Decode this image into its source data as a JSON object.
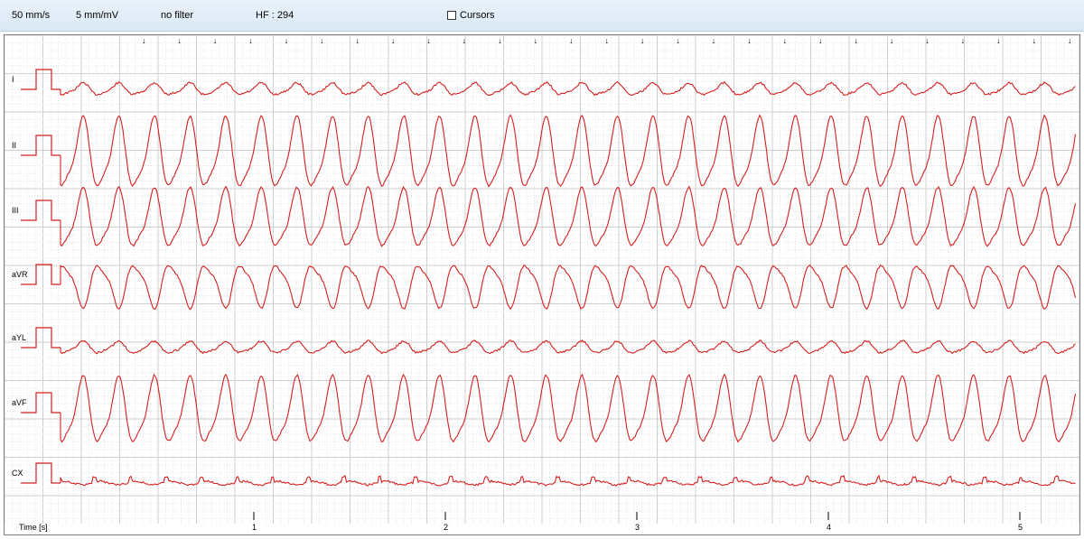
{
  "toolbar": {
    "speed": "50 mm/s",
    "gain": "5 mm/mV",
    "filter": "no filter",
    "heart_rate": "HF : 294",
    "cursors_label": "Cursors",
    "cursors_checked": false
  },
  "leads": [
    {
      "label": "I",
      "amplitude": 0.15
    },
    {
      "label": "II",
      "amplitude": 0.9
    },
    {
      "label": "III",
      "amplitude": 0.75
    },
    {
      "label": "aVR",
      "amplitude": -0.55
    },
    {
      "label": "aYL",
      "amplitude": 0.15
    },
    {
      "label": "aVF",
      "amplitude": 0.85
    },
    {
      "label": "CX",
      "amplitude": 0.1
    }
  ],
  "time_axis": {
    "label": "Time [s]",
    "ticks": [
      "1",
      "2",
      "3",
      "4",
      "5"
    ]
  },
  "beat_marker_count": 27,
  "colors": {
    "trace": "#d42020",
    "grid_major": "#cfcfcf",
    "grid_minor": "#e4e4e4",
    "toolbar_bg": "#dbe8f6"
  }
}
